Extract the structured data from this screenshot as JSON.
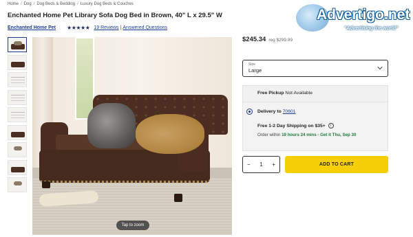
{
  "breadcrumb": [
    "Home",
    "Dog",
    "Dog Beds & Bedding",
    "Luxury Dog Beds & Couches"
  ],
  "product": {
    "title": "Enchanted Home Pet Library Sofa Dog Bed in Brown, 40\" L x 29.5\" W",
    "brand": "Enchanted Home Pet",
    "rating_stars": "★★★★★",
    "rating": 4.5,
    "reviews": "19 Reviews",
    "separator": "|",
    "questions": "Answered Questions"
  },
  "watermark": {
    "brand": "Advertigo.net",
    "tagline": "\"Advertising the world\""
  },
  "gallery": {
    "thumbnail_count": 9,
    "zoom_hint": "Tap to zoom"
  },
  "pricing": {
    "price": "$245.34",
    "regular": "reg $299.99"
  },
  "size": {
    "label": "Size",
    "value": "Large"
  },
  "fulfillment": {
    "pickup_label": "Free Pickup",
    "pickup_status": "Not Available",
    "delivery_label": "Delivery to",
    "zip": "70601",
    "shipping": "Free 1-2 Day Shipping on $35+",
    "order_prefix": "Order within",
    "order_highlight": "19 hours 24 mins - Get it Thu, Sep 30"
  },
  "cart": {
    "quantity": "1",
    "minus": "−",
    "plus": "+",
    "add_label": "ADD TO CART"
  },
  "colors": {
    "accent": "#1a3b8f",
    "cart_button": "#f7cf08",
    "delivery_highlight": "#1f7a3a"
  }
}
